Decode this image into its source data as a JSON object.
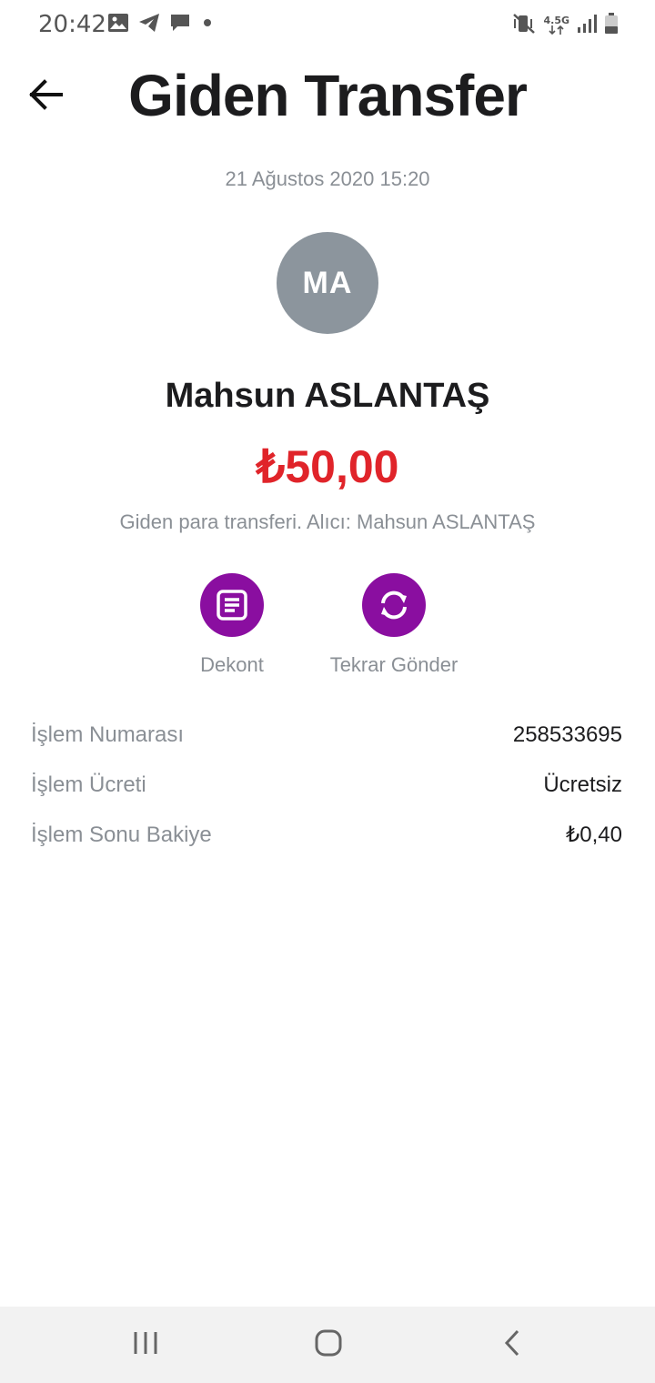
{
  "status_bar": {
    "time": "20:42",
    "network_type": "4.5G",
    "left_icons": [
      "gallery-icon",
      "telegram-icon",
      "message-icon",
      "dot-icon"
    ],
    "right_icons": [
      "mute-vibrate-icon",
      "network-4.5g-icon",
      "signal-icon",
      "battery-icon"
    ]
  },
  "header": {
    "title": "Giden Transfer",
    "back_icon": "arrow-left-icon"
  },
  "transaction": {
    "date": "21 Ağustos 2020 15:20",
    "avatar_initials": "MA",
    "recipient_name": "Mahsun ASLANTAŞ",
    "amount": "₺50,00",
    "description": "Giden para transferi. Alıcı: Mahsun ASLANTAŞ"
  },
  "actions": [
    {
      "label": "Dekont",
      "icon": "receipt-icon"
    },
    {
      "label": "Tekrar Gönder",
      "icon": "repeat-icon"
    }
  ],
  "details": [
    {
      "label": "İşlem Numarası",
      "value": "258533695"
    },
    {
      "label": "İşlem Ücreti",
      "value": "Ücretsiz"
    },
    {
      "label": "İşlem Sonu Bakiye",
      "value": "₺0,40"
    }
  ],
  "nav_bar": {
    "icons": [
      "recent-apps-icon",
      "home-icon",
      "back-nav-icon"
    ]
  },
  "colors": {
    "accent": "#8a0ea0",
    "amount": "#e0242a",
    "avatar_bg": "#8c959d",
    "muted_text": "#8a8f95"
  }
}
